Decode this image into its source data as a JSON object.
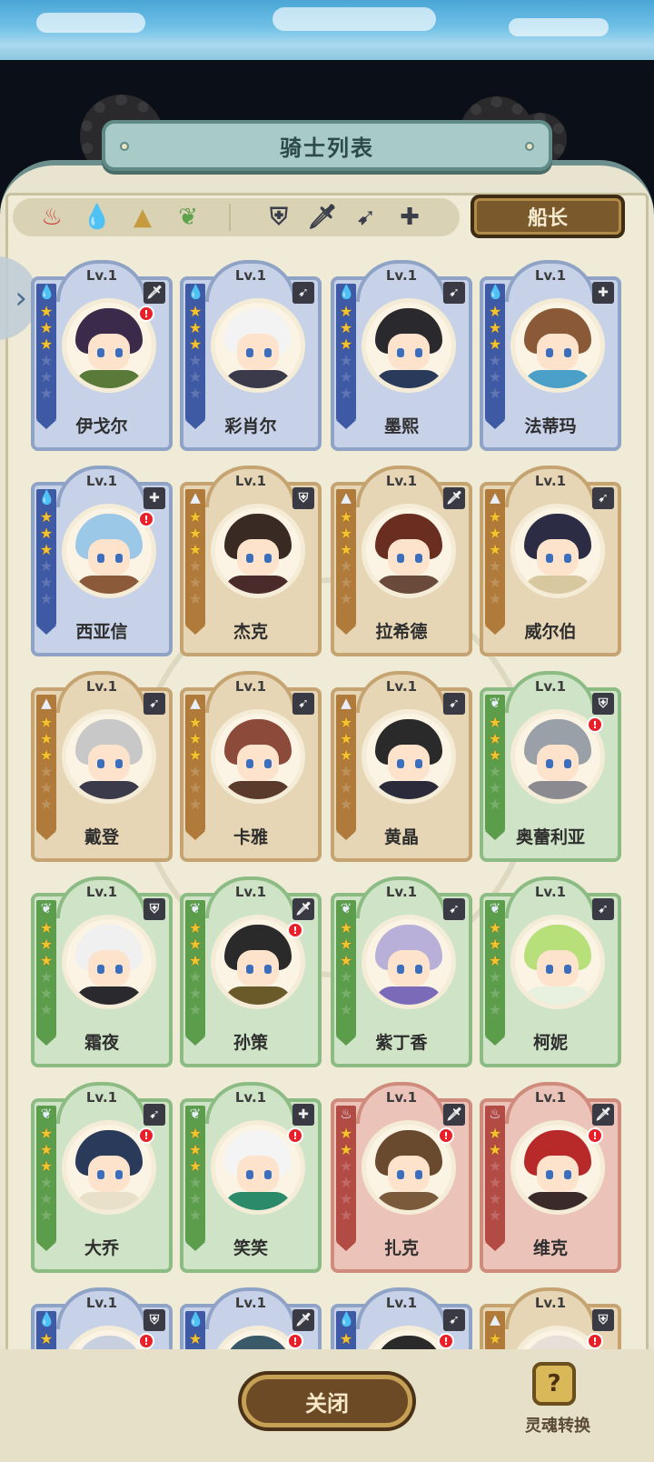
{
  "header": {
    "title": "骑士列表"
  },
  "filters": {
    "elements": [
      {
        "icon": "fire-element-icon",
        "color": "#c8433c"
      },
      {
        "icon": "water-element-icon",
        "color": "#3f69b8"
      },
      {
        "icon": "earth-element-icon",
        "color": "#c69a3f"
      },
      {
        "icon": "wind-element-icon",
        "color": "#5ea24b"
      }
    ],
    "classes": [
      {
        "icon": "shield-class-icon",
        "glyph": "⛨"
      },
      {
        "icon": "sword-class-icon",
        "glyph": "🗡"
      },
      {
        "icon": "bow-class-icon",
        "glyph": "➹"
      },
      {
        "icon": "healer-class-icon",
        "glyph": "✚"
      }
    ],
    "captain_label": "船长"
  },
  "knights": [
    {
      "name": "伊戈尔",
      "level": "Lv.1",
      "element": "water",
      "class": "sword",
      "stars": 3,
      "badge": true
    },
    {
      "name": "彩肖尔",
      "level": "Lv.1",
      "element": "water",
      "class": "bow",
      "stars": 3,
      "badge": false
    },
    {
      "name": "墨熙",
      "level": "Lv.1",
      "element": "water",
      "class": "bow",
      "stars": 3,
      "badge": false
    },
    {
      "name": "法蒂玛",
      "level": "Lv.1",
      "element": "water",
      "class": "healer",
      "stars": 3,
      "badge": false
    },
    {
      "name": "西亚信",
      "level": "Lv.1",
      "element": "water",
      "class": "healer",
      "stars": 3,
      "badge": true
    },
    {
      "name": "杰克",
      "level": "Lv.1",
      "element": "earth",
      "class": "shield",
      "stars": 3,
      "badge": false
    },
    {
      "name": "拉希德",
      "level": "Lv.1",
      "element": "earth",
      "class": "sword",
      "stars": 3,
      "badge": false
    },
    {
      "name": "威尔伯",
      "level": "Lv.1",
      "element": "earth",
      "class": "bow",
      "stars": 3,
      "badge": false
    },
    {
      "name": "戴登",
      "level": "Lv.1",
      "element": "earth",
      "class": "bow",
      "stars": 3,
      "badge": false
    },
    {
      "name": "卡雅",
      "level": "Lv.1",
      "element": "earth",
      "class": "bow",
      "stars": 3,
      "badge": false
    },
    {
      "name": "黄晶",
      "level": "Lv.1",
      "element": "earth",
      "class": "bow",
      "stars": 3,
      "badge": false
    },
    {
      "name": "奥蕾利亚",
      "level": "Lv.1",
      "element": "wind",
      "class": "shield",
      "stars": 3,
      "badge": true
    },
    {
      "name": "霜夜",
      "level": "Lv.1",
      "element": "wind",
      "class": "shield",
      "stars": 3,
      "badge": false
    },
    {
      "name": "孙策",
      "level": "Lv.1",
      "element": "wind",
      "class": "sword",
      "stars": 3,
      "badge": true
    },
    {
      "name": "紫丁香",
      "level": "Lv.1",
      "element": "wind",
      "class": "bow",
      "stars": 3,
      "badge": false
    },
    {
      "name": "柯妮",
      "level": "Lv.1",
      "element": "wind",
      "class": "bow",
      "stars": 3,
      "badge": false
    },
    {
      "name": "大乔",
      "level": "Lv.1",
      "element": "wind",
      "class": "bow",
      "stars": 3,
      "badge": true
    },
    {
      "name": "笑笑",
      "level": "Lv.1",
      "element": "wind",
      "class": "healer",
      "stars": 3,
      "badge": true
    },
    {
      "name": "扎克",
      "level": "Lv.1",
      "element": "fire",
      "class": "sword",
      "stars": 2,
      "badge": true
    },
    {
      "name": "维克",
      "level": "Lv.1",
      "element": "fire",
      "class": "sword",
      "stars": 2,
      "badge": true
    },
    {
      "name": "",
      "level": "Lv.1",
      "element": "water",
      "class": "shield",
      "stars": 3,
      "badge": true
    },
    {
      "name": "",
      "level": "Lv.1",
      "element": "water",
      "class": "sword",
      "stars": 3,
      "badge": true
    },
    {
      "name": "",
      "level": "Lv.1",
      "element": "water",
      "class": "bow",
      "stars": 3,
      "badge": true
    },
    {
      "name": "",
      "level": "Lv.1",
      "element": "earth",
      "class": "shield",
      "stars": 3,
      "badge": true
    }
  ],
  "footer": {
    "close_label": "关闭",
    "soul_convert_label": "灵魂转换"
  }
}
